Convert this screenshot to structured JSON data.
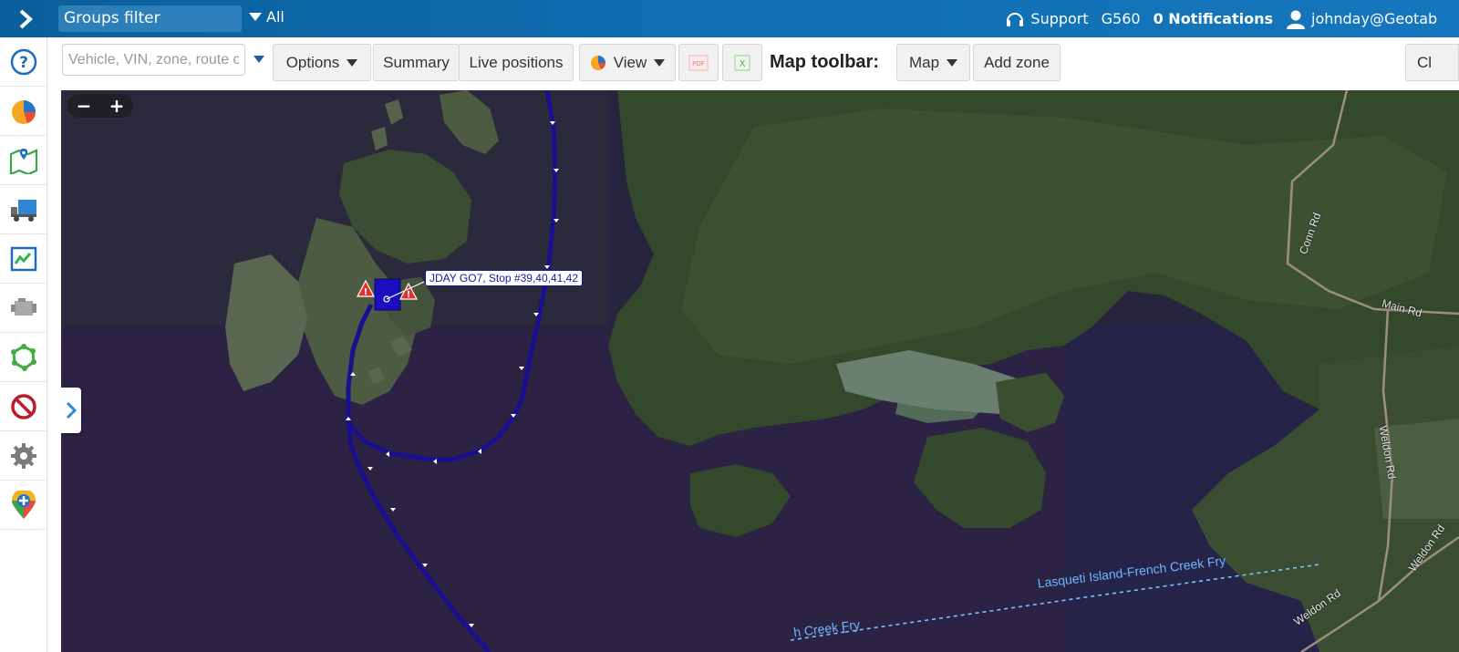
{
  "header": {
    "groups_filter_label": "Groups filter",
    "groups_scope": "All",
    "support_label": "Support",
    "device_label": "G560",
    "notifications_label": "0 Notifications",
    "user_label": "johnday@Geotab"
  },
  "nav": {
    "items": [
      {
        "name": "help-icon"
      },
      {
        "name": "dashboard-pie-icon"
      },
      {
        "name": "map-icon"
      },
      {
        "name": "vehicles-truck-icon"
      },
      {
        "name": "activity-chart-icon"
      },
      {
        "name": "engine-icon"
      },
      {
        "name": "zones-icon"
      },
      {
        "name": "rules-exceptions-icon"
      },
      {
        "name": "settings-gear-icon"
      },
      {
        "name": "marketplace-icon"
      }
    ]
  },
  "toolbar": {
    "search_placeholder": "Vehicle, VIN, zone, route o",
    "options_label": "Options",
    "summary_label": "Summary",
    "live_positions_label": "Live positions",
    "view_label": "View",
    "pdf_label": "PDF",
    "excel_label": "X",
    "map_toolbar_label": "Map toolbar:",
    "map_label": "Map",
    "add_zone_label": "Add zone",
    "cut_label": "Cl"
  },
  "map": {
    "zoom_out": "−",
    "zoom_in": "+",
    "stop_label": "JDAY GO7, Stop #39,40,41,42",
    "roads": {
      "conn": "Conn Rd",
      "main": "Main Rd",
      "weldon_1": "Weldon Rd",
      "weldon_2": "Weldon Rd",
      "weldon_3": "Weldon Rd"
    },
    "ferry_1": "Lasqueti Island-French Creek Fry",
    "ferry_2": "h Creek Fry"
  },
  "colors": {
    "header": "#0f6db0",
    "route": "#1a0f8f",
    "water": "#27243f",
    "forest": "#34482c"
  }
}
